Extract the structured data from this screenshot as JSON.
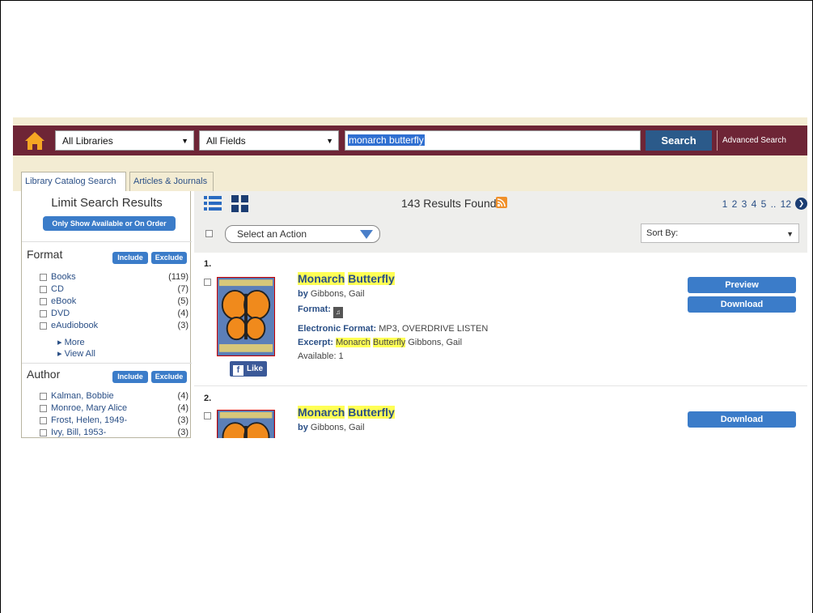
{
  "search": {
    "library_scope": "All Libraries",
    "field_scope": "All Fields",
    "query": "monarch butterfly",
    "search_label": "Search",
    "advanced_label": "Advanced Search"
  },
  "tabs": [
    {
      "label": "Library Catalog Search",
      "active": true
    },
    {
      "label": "Articles & Journals",
      "active": false
    }
  ],
  "sidebar": {
    "title": "Limit Search Results",
    "available_label": "Only Show Available or On Order",
    "include_label": "Include",
    "exclude_label": "Exclude",
    "format": {
      "heading": "Format",
      "items": [
        {
          "label": "Books",
          "count": "(119)"
        },
        {
          "label": "CD",
          "count": "(7)"
        },
        {
          "label": "eBook",
          "count": "(5)"
        },
        {
          "label": "DVD",
          "count": "(4)"
        },
        {
          "label": "eAudiobook",
          "count": "(3)"
        }
      ],
      "more_label": "▸ More",
      "view_all_label": "▸ View All"
    },
    "author": {
      "heading": "Author",
      "items": [
        {
          "label": "Kalman, Bobbie",
          "count": "(4)"
        },
        {
          "label": "Monroe, Mary Alice",
          "count": "(4)"
        },
        {
          "label": "Frost, Helen, 1949-",
          "count": "(3)"
        },
        {
          "label": "Ivy, Bill, 1953-",
          "count": "(3)"
        }
      ]
    }
  },
  "results": {
    "count_label": "143 Results Found",
    "pages": "1 2 3 4 5 .. 12",
    "next_glyph": "❯",
    "action_label": "Select an Action",
    "sort_label": "Sort By:",
    "records": [
      {
        "number": "1.",
        "title_a": "Monarch",
        "title_b": "Butterfly",
        "by_label": "by",
        "author": "Gibbons, Gail",
        "format_label": "Format:",
        "eformat_label": "Electronic Format:",
        "eformat_value": "MP3, OVERDRIVE LISTEN",
        "excerpt_label": "Excerpt:",
        "excerpt_a": "Monarch",
        "excerpt_b": "Butterfly",
        "excerpt_rest": "Gibbons, Gail",
        "available": "Available: 1",
        "like_label": "Like",
        "preview_label": "Preview",
        "download_label": "Download"
      },
      {
        "number": "2.",
        "title_a": "Monarch",
        "title_b": "Butterfly",
        "by_label": "by",
        "author": "Gibbons, Gail",
        "download_label": "Download"
      }
    ]
  },
  "colors": {
    "header_bar": "#6e2536",
    "tab_band": "#f3ecd3",
    "button_blue": "#3b7cc9",
    "highlight": "#ffff55"
  }
}
